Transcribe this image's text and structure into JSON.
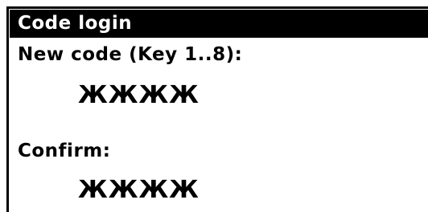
{
  "dialog": {
    "title": "Code login",
    "new_code": {
      "label": "New code (Key 1..8):",
      "value": "ЖЖЖЖ"
    },
    "confirm": {
      "label": "Confirm:",
      "value": "ЖЖЖЖ"
    }
  },
  "colors": {
    "background": "#ffffff",
    "title_bar": "#000000",
    "title_text": "#ffffff",
    "text": "#000000"
  }
}
